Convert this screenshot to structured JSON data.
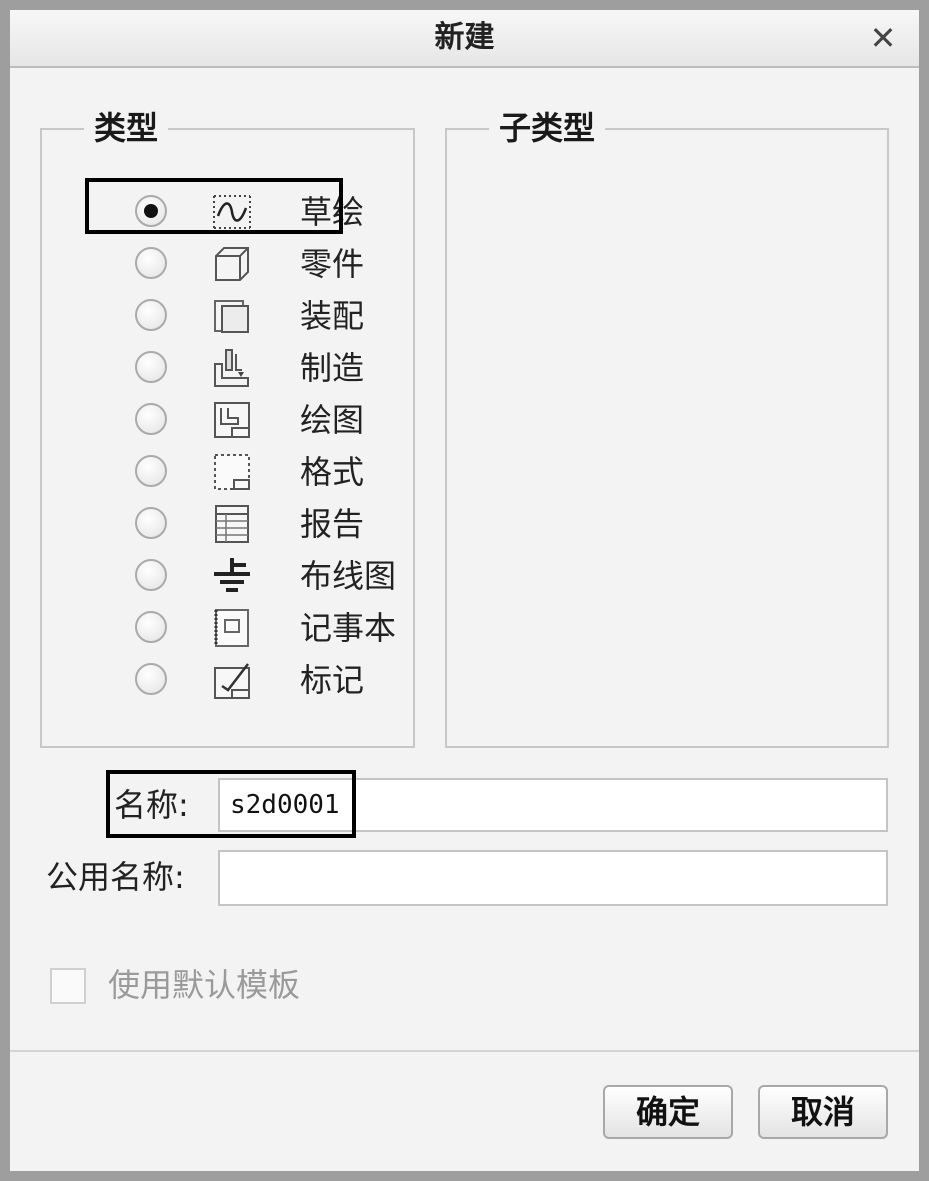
{
  "dialog": {
    "title": "新建",
    "close_glyph": "✕"
  },
  "type_group": {
    "legend": "类型",
    "selected": "草绘",
    "items": [
      {
        "label": "草绘",
        "icon": "sketch-icon",
        "checked": true
      },
      {
        "label": "零件",
        "icon": "part-icon",
        "checked": false
      },
      {
        "label": "装配",
        "icon": "assembly-icon",
        "checked": false
      },
      {
        "label": "制造",
        "icon": "manufacturing-icon",
        "checked": false
      },
      {
        "label": "绘图",
        "icon": "drawing-icon",
        "checked": false
      },
      {
        "label": "格式",
        "icon": "format-icon",
        "checked": false
      },
      {
        "label": "报告",
        "icon": "report-icon",
        "checked": false
      },
      {
        "label": "布线图",
        "icon": "diagram-icon",
        "checked": false
      },
      {
        "label": "记事本",
        "icon": "layout-icon",
        "checked": false
      },
      {
        "label": "标记",
        "icon": "markup-icon",
        "checked": false
      }
    ]
  },
  "subtype_group": {
    "legend": "子类型"
  },
  "form": {
    "name_label": "名称:",
    "name_value": "s2d0001",
    "common_name_label": "公用名称:",
    "common_name_value": ""
  },
  "template_option": {
    "label": "使用默认模板",
    "checked": false,
    "enabled": false
  },
  "buttons": {
    "ok": "确定",
    "cancel": "取消"
  }
}
